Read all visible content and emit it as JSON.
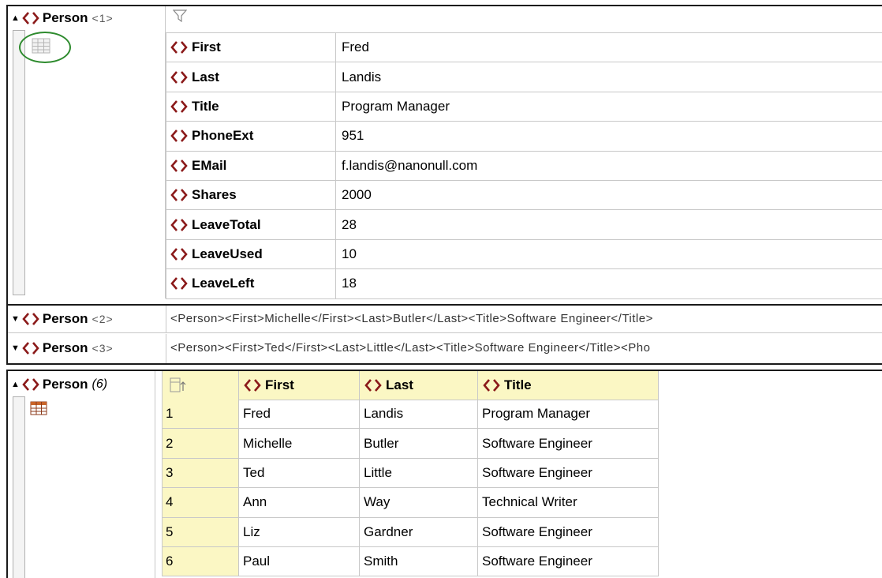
{
  "top": {
    "person1": {
      "label": "Person",
      "index": "<1>",
      "fields": [
        {
          "name": "First",
          "value": "Fred"
        },
        {
          "name": "Last",
          "value": "Landis"
        },
        {
          "name": "Title",
          "value": "Program Manager"
        },
        {
          "name": "PhoneExt",
          "value": "951"
        },
        {
          "name": "EMail",
          "value": "f.landis@nanonull.com"
        },
        {
          "name": "Shares",
          "value": "2000"
        },
        {
          "name": "LeaveTotal",
          "value": "28"
        },
        {
          "name": "LeaveUsed",
          "value": "10"
        },
        {
          "name": "LeaveLeft",
          "value": "18"
        }
      ]
    },
    "person2": {
      "label": "Person",
      "index": "<2>",
      "raw": "<Person><First>Michelle</First><Last>Butler</Last><Title>Software Engineer</Title>"
    },
    "person3": {
      "label": "Person",
      "index": "<3>",
      "raw": "<Person><First>Ted</First><Last>Little</Last><Title>Software Engineer</Title><Pho"
    }
  },
  "bottom": {
    "label": "Person",
    "count": "(6)",
    "columns": [
      "First",
      "Last",
      "Title"
    ],
    "rows": [
      {
        "n": "1",
        "first": "Fred",
        "last": "Landis",
        "title": "Program Manager"
      },
      {
        "n": "2",
        "first": "Michelle",
        "last": "Butler",
        "title": "Software Engineer"
      },
      {
        "n": "3",
        "first": "Ted",
        "last": "Little",
        "title": "Software Engineer"
      },
      {
        "n": "4",
        "first": "Ann",
        "last": "Way",
        "title": "Technical Writer"
      },
      {
        "n": "5",
        "first": "Liz",
        "last": "Gardner",
        "title": "Software Engineer"
      },
      {
        "n": "6",
        "first": "Paul",
        "last": "Smith",
        "title": "Software Engineer"
      }
    ]
  },
  "colors": {
    "tag_icon": "#8b1a1a",
    "highlight_ring": "#2e8b2e",
    "header_yellow": "#fbf7c4",
    "rownum_yellow": "#fbf7c4",
    "grid_line": "#c8c8c8",
    "frame": "#1a1a1a"
  }
}
